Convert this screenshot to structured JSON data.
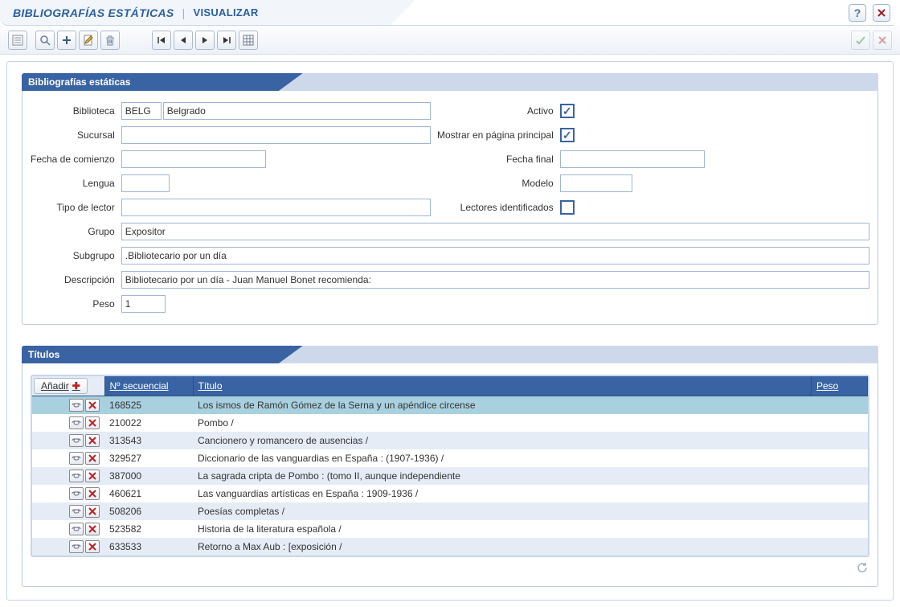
{
  "header": {
    "breadcrumb_main": "BIBLIOGRAFÍAS ESTÁTICAS",
    "breadcrumb_sub": "VISUALIZAR"
  },
  "panel_biblio": {
    "title": "Bibliografías estáticas",
    "labels": {
      "biblioteca": "Biblioteca",
      "sucursal": "Sucursal",
      "fecha_comienzo": "Fecha de comienzo",
      "lengua": "Lengua",
      "tipo_lector": "Tipo de lector",
      "grupo": "Grupo",
      "subgrupo": "Subgrupo",
      "descripcion": "Descripción",
      "peso": "Peso",
      "activo": "Activo",
      "mostrar_principal": "Mostrar en página principal",
      "fecha_final": "Fecha final",
      "modelo": "Modelo",
      "lectores_identificados": "Lectores identificados"
    },
    "values": {
      "biblioteca_code": "BELG",
      "biblioteca_name": "Belgrado",
      "sucursal": "",
      "fecha_comienzo": "",
      "lengua": "",
      "tipo_lector": "",
      "grupo": "Expositor",
      "subgrupo": ".Bibliotecario por un día",
      "descripcion": "Bibliotecario por un día - Juan Manuel Bonet recomienda:",
      "peso": "1",
      "fecha_final": "",
      "modelo": ""
    },
    "checks": {
      "activo": true,
      "mostrar_principal": true,
      "lectores_identificados": false
    }
  },
  "panel_titulos": {
    "title": "Títulos",
    "add_label": "Añadir",
    "columns": {
      "secuencial": "Nº secuencial",
      "titulo": "Título",
      "peso": "Peso"
    },
    "rows": [
      {
        "secuencial": "168525",
        "titulo": "Los ismos de Ramón Gómez de la Serna y un apéndice circense",
        "peso": "",
        "selected": true
      },
      {
        "secuencial": "210022",
        "titulo": "Pombo /",
        "peso": ""
      },
      {
        "secuencial": "313543",
        "titulo": "Cancionero y romancero de ausencias /",
        "peso": ""
      },
      {
        "secuencial": "329527",
        "titulo": "Diccionario de las vanguardias en España : (1907-1936) /",
        "peso": ""
      },
      {
        "secuencial": "387000",
        "titulo": "La sagrada cripta de Pombo : (tomo II, aunque independiente",
        "peso": ""
      },
      {
        "secuencial": "460621",
        "titulo": "Las vanguardias artísticas en España : 1909-1936 /",
        "peso": ""
      },
      {
        "secuencial": "508206",
        "titulo": "Poesías completas /",
        "peso": ""
      },
      {
        "secuencial": "523582",
        "titulo": "Historia de la literatura española /",
        "peso": ""
      },
      {
        "secuencial": "633533",
        "titulo": "Retorno a Max Aub : [exposición /",
        "peso": ""
      }
    ]
  }
}
